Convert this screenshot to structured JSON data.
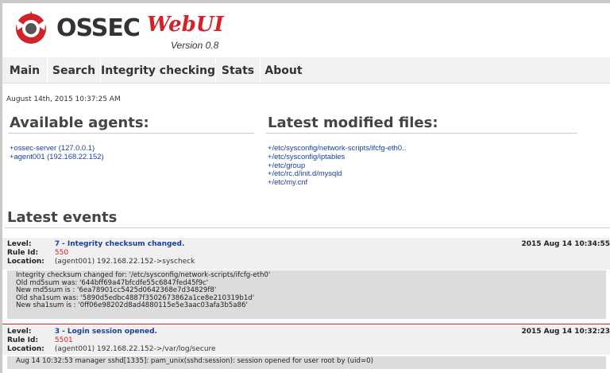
{
  "header": {
    "logo_text": "OSSEC",
    "logo_webui": "WebUI",
    "version": "Version 0.8"
  },
  "nav": {
    "tabs": [
      {
        "label": "Main"
      },
      {
        "label": "Search"
      },
      {
        "label": "Integrity checking"
      },
      {
        "label": "Stats"
      },
      {
        "label": "About"
      }
    ]
  },
  "timestamp": "August 14th, 2015 10:37:25 AM",
  "agents": {
    "title": "Available agents:",
    "items": [
      "+ossec-server (127.0.0.1)",
      "+agent001 (192.168.22.152)"
    ]
  },
  "modified_files": {
    "title": "Latest modified files:",
    "items": [
      "+/etc/sysconfig/network-scripts/ifcfg-eth0..",
      "+/etc/sysconfig/iptables",
      "+/etc/group",
      "+/etc/rc.d/init.d/mysqld",
      "+/etc/my.cnf"
    ]
  },
  "events": {
    "title": "Latest events",
    "labels": {
      "level": "Level:",
      "rule_id": "Rule Id:",
      "location": "Location:"
    },
    "items": [
      {
        "level": "7",
        "description": "Integrity checksum changed.",
        "rule_id": "550",
        "location": "(agent001) 192.168.22.152->syscheck",
        "date": "2015 Aug 14 10:34:55",
        "details": [
          "Integrity checksum changed for: '/etc/sysconfig/network-scripts/ifcfg-eth0'",
          "Old md5sum was: '644bff69a47bfcdfe55c6847fed45f9c'",
          "New md5sum is : '6ea78901cc5425d0642368e7d34829f8'",
          "Old sha1sum was: '5890d5edbc4887f3502673862a1ce8e210319b1d'",
          "New sha1sum is : '0ff06e98202d8ad4880115e5e3aac03afa3b5a86'"
        ]
      },
      {
        "level": "3",
        "description": "Login session opened.",
        "rule_id": "5501",
        "location": "(agent001) 192.168.22.152->/var/log/secure",
        "date": "2015 Aug 14 10:32:23",
        "details": [
          "Aug 14 10:32:53 manager sshd[1335]: pam_unix(sshd:session): session opened for user root by (uid=0)"
        ]
      }
    ]
  },
  "colors": {
    "brand_red": "#d2232a",
    "link_blue": "#1a3f9a",
    "nav_bg": "#f2f2f2",
    "event_bg": "#f0f0f0",
    "detail_bg": "#dcdcdc"
  }
}
